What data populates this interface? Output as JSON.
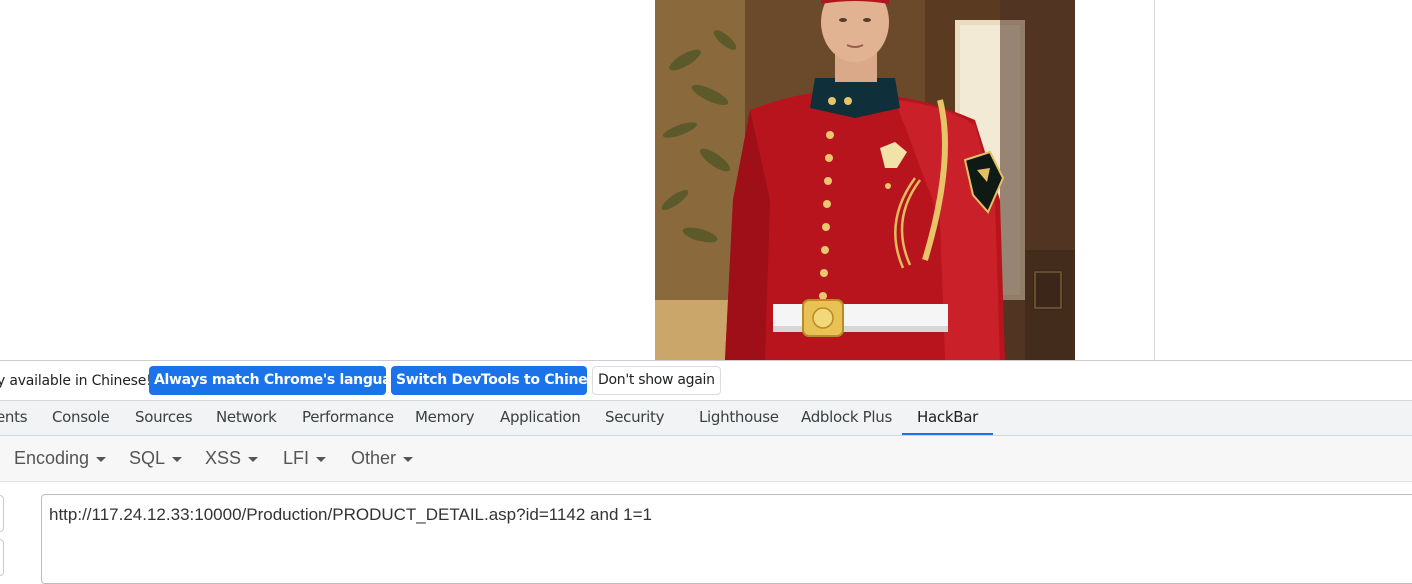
{
  "page": {
    "image_alt": "Man in red ceremonial guard uniform"
  },
  "devtools": {
    "infobar": {
      "message": "DevTools is now available in Chinese!",
      "visible_message": "y available in Chinese!",
      "always_match_label": "Always match Chrome's language",
      "switch_label": "Switch DevTools to Chinese",
      "dont_show_label": "Don't show again"
    },
    "tabs": [
      "ents",
      "Console",
      "Sources",
      "Network",
      "Performance",
      "Memory",
      "Application",
      "Security",
      "Lighthouse",
      "Adblock Plus",
      "HackBar"
    ],
    "active_tab": "HackBar",
    "colors": {
      "accent": "#1a73e8",
      "tab_bar": "#f1f3f4"
    }
  },
  "hackbar": {
    "menus": [
      "Encoding",
      "SQL",
      "XSS",
      "LFI",
      "Other"
    ],
    "url_value": "http://117.24.12.33:10000/Production/PRODUCT_DETAIL.asp?id=1142 and 1=1"
  }
}
